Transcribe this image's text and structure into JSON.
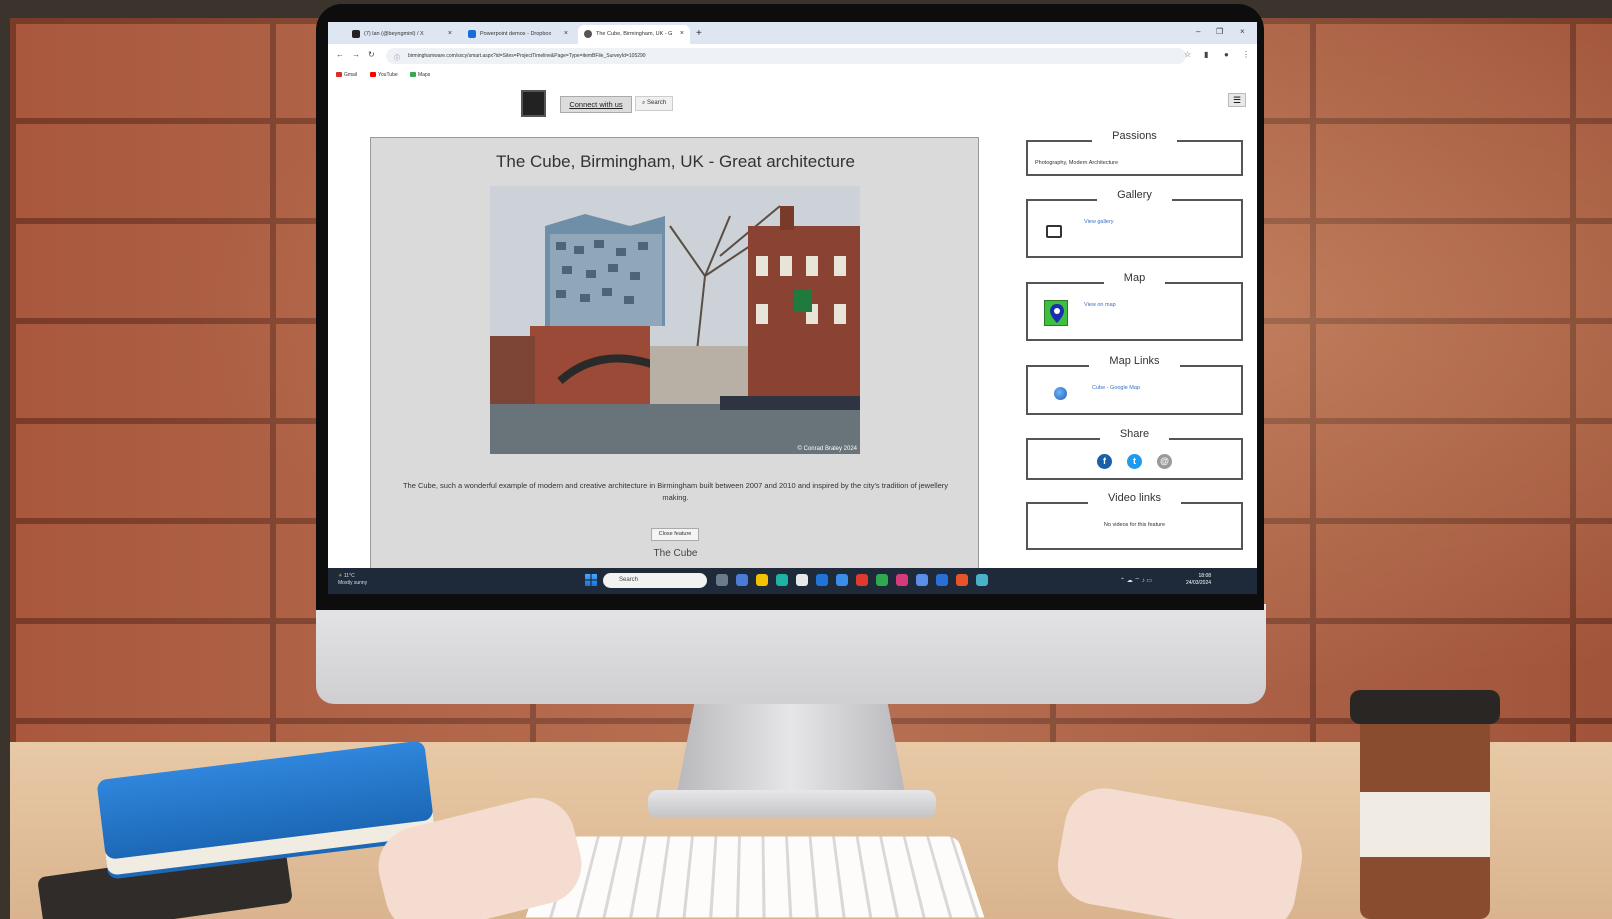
{
  "browser": {
    "tabs": [
      {
        "label": "(7) lan (@beyngminl) / X",
        "active": false
      },
      {
        "label": "Powerpoint demos - Dropbox",
        "active": false
      },
      {
        "label": "The Cube, Birmingham, UK - G",
        "active": true
      }
    ],
    "url": "birminghamware.com/sxcy/smart.aspx?id=Sites=ProjectTimeline&Page=Type=itemBFile_SurveyId=105290",
    "bookmarks": [
      "Gmail",
      "YouTube",
      "Maps"
    ]
  },
  "site": {
    "header": {
      "connect_label": "Connect with us",
      "search_label": "Search"
    },
    "feature": {
      "title": "The Cube, Birmingham, UK - Great architecture",
      "photo_credit": "© Conrad Braley 2024",
      "description": "The Cube, such a wonderful example of modern and creative architecture in Birmingham built between 2007 and 2010 and inspired by the city's tradition of jewellery making.",
      "close_label": "Close feature",
      "name": "The Cube"
    },
    "sidebar": {
      "passions": {
        "title": "Passions",
        "text": "Photography, Modern Architecture"
      },
      "gallery": {
        "title": "Gallery",
        "link": "View gallery"
      },
      "map": {
        "title": "Map",
        "link": "View on map"
      },
      "map_links": {
        "title": "Map Links",
        "link": "Cube - Google Map"
      },
      "share": {
        "title": "Share"
      },
      "video_links": {
        "title": "Video links",
        "text": "No videos for this feature"
      }
    }
  },
  "taskbar": {
    "weather": "11°C\nMostly sunny",
    "search_placeholder": "Search",
    "time": "18:08",
    "date": "24/03/2024"
  },
  "colors": {
    "facebook": "#1b5fa8",
    "twitter": "#1d9bf0",
    "email": "#9a9a9a"
  }
}
